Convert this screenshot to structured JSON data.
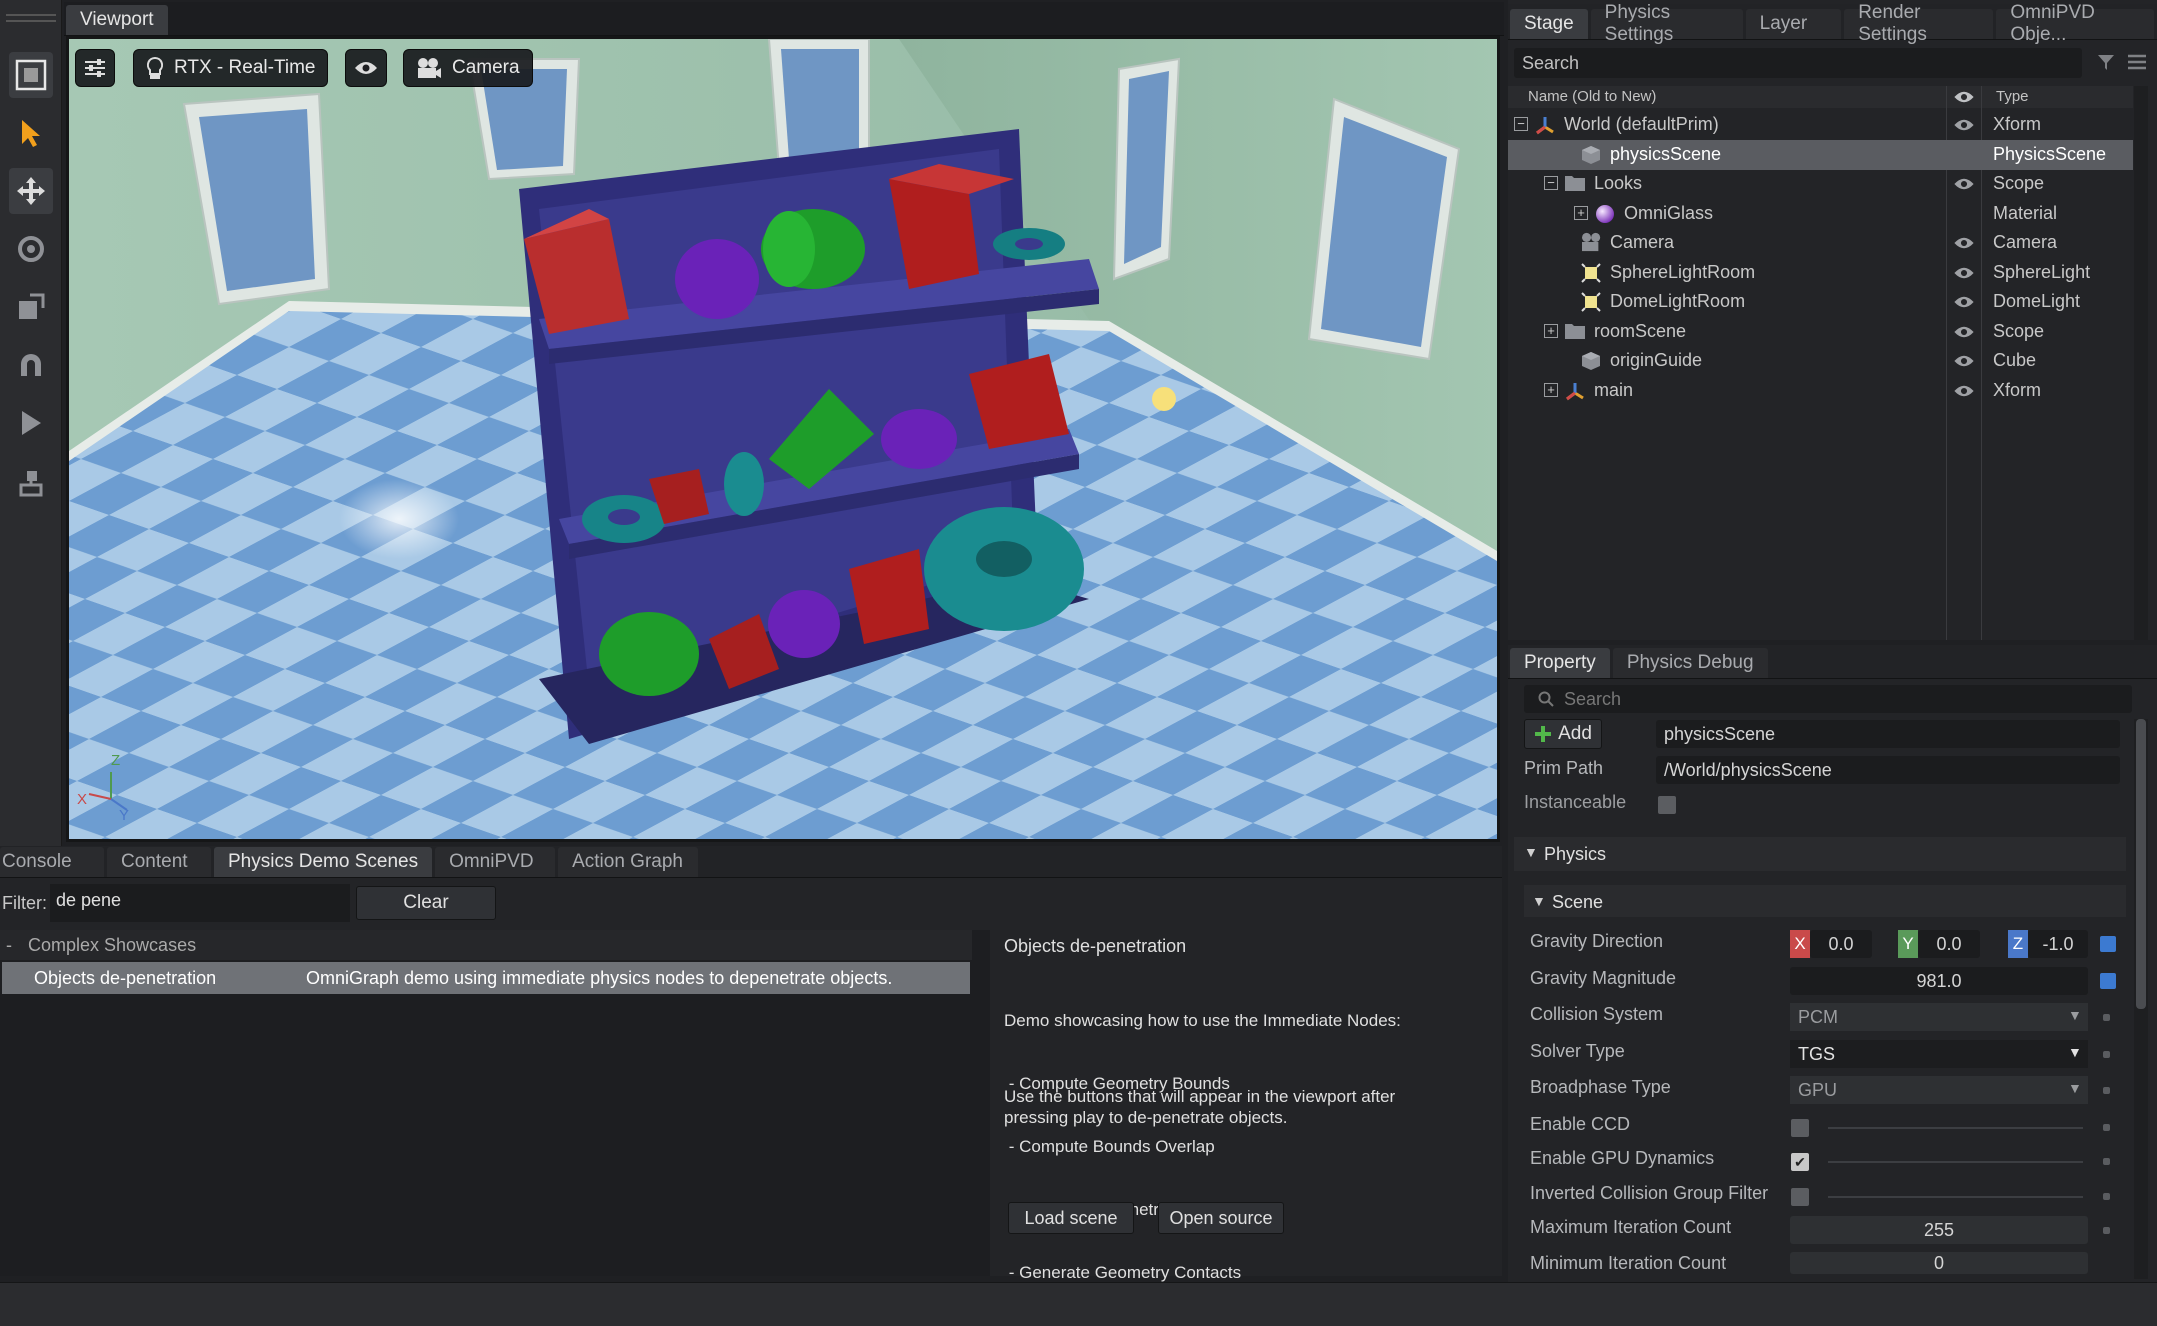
{
  "viewport": {
    "tab": "Viewport",
    "render_mode": "RTX - Real-Time",
    "camera": "Camera",
    "axis_labels": {
      "x": "X",
      "y": "Y",
      "z": "Z"
    }
  },
  "stage": {
    "tabs": [
      "Stage",
      "Physics Settings",
      "Layer",
      "Render Settings",
      "OmniPVD Obje..."
    ],
    "search_placeholder": "Search",
    "col_name": "Name (Old to New)",
    "col_type": "Type",
    "rows": [
      {
        "name": "World (defaultPrim)",
        "type": "Xform",
        "icon": "xform-icon"
      },
      {
        "name": "physicsScene",
        "type": "PhysicsScene",
        "icon": "cube-icon"
      },
      {
        "name": "Looks",
        "type": "Scope",
        "icon": "folder-icon"
      },
      {
        "name": "OmniGlass",
        "type": "Material",
        "icon": "material-sphere-icon"
      },
      {
        "name": "Camera",
        "type": "Camera",
        "icon": "camera-icon"
      },
      {
        "name": "SphereLightRoom",
        "type": "SphereLight",
        "icon": "light-icon"
      },
      {
        "name": "DomeLightRoom",
        "type": "DomeLight",
        "icon": "light-icon"
      },
      {
        "name": "roomScene",
        "type": "Scope",
        "icon": "folder-icon"
      },
      {
        "name": "originGuide",
        "type": "Cube",
        "icon": "cube-icon"
      },
      {
        "name": "main",
        "type": "Xform",
        "icon": "xform-icon"
      }
    ]
  },
  "property": {
    "tabs": [
      "Property",
      "Physics Debug"
    ],
    "search_placeholder": "Search",
    "add_label": "Add",
    "prim_name": "physicsScene",
    "prim_path_label": "Prim Path",
    "prim_path": "/World/physicsScene",
    "instanceable_label": "Instanceable",
    "physics_section": "Physics",
    "scene_section": "Scene",
    "gravity_direction_label": "Gravity Direction",
    "gravity": {
      "x_label": "X",
      "x": "0.0",
      "y_label": "Y",
      "y": "0.0",
      "z_label": "Z",
      "z": "-1.0"
    },
    "gravity_magnitude_label": "Gravity Magnitude",
    "gravity_magnitude": "981.0",
    "collision_system_label": "Collision System",
    "collision_system": "PCM",
    "solver_type_label": "Solver Type",
    "solver_type": "TGS",
    "broadphase_label": "Broadphase Type",
    "broadphase": "GPU",
    "enable_ccd_label": "Enable CCD",
    "enable_ccd": false,
    "enable_gpu_label": "Enable GPU Dynamics",
    "enable_gpu": true,
    "inverted_label": "Inverted Collision Group Filter",
    "inverted": false,
    "max_iter_label": "Maximum Iteration Count",
    "max_iter": "255",
    "min_iter_label": "Minimum Iteration Count",
    "min_iter": "0"
  },
  "bottom": {
    "tabs": [
      "Console",
      "Content",
      "Physics Demo Scenes",
      "OmniPVD",
      "Action Graph"
    ],
    "filter_label": "Filter:",
    "filter_value": "de pene",
    "clear_label": "Clear",
    "group_toggle": "-",
    "group_name": "Complex Showcases",
    "demo_name": "Objects de-penetration",
    "demo_desc": "OmniGraph demo using immediate physics nodes to depenetrate objects.",
    "detail_title": "Objects de-penetration",
    "detail_lines": [
      "Demo showcasing how to use the Immediate Nodes:",
      " - Compute Geometry Bounds",
      " - Compute Bounds Overlap",
      " - Compute Geometry Penetration",
      " - Generate Geometry Contacts"
    ],
    "detail_note_1": "Use the buttons that will appear in the viewport after",
    "detail_note_2": "pressing play to de-penetrate objects.",
    "load_label": "Load scene",
    "open_label": "Open source"
  },
  "colors": {
    "accent_selected": "#5a5c61",
    "gravity_x": "#c94a4a",
    "gravity_y": "#5a9a5a",
    "gravity_z": "#4a78c9",
    "panel": "#232427"
  }
}
